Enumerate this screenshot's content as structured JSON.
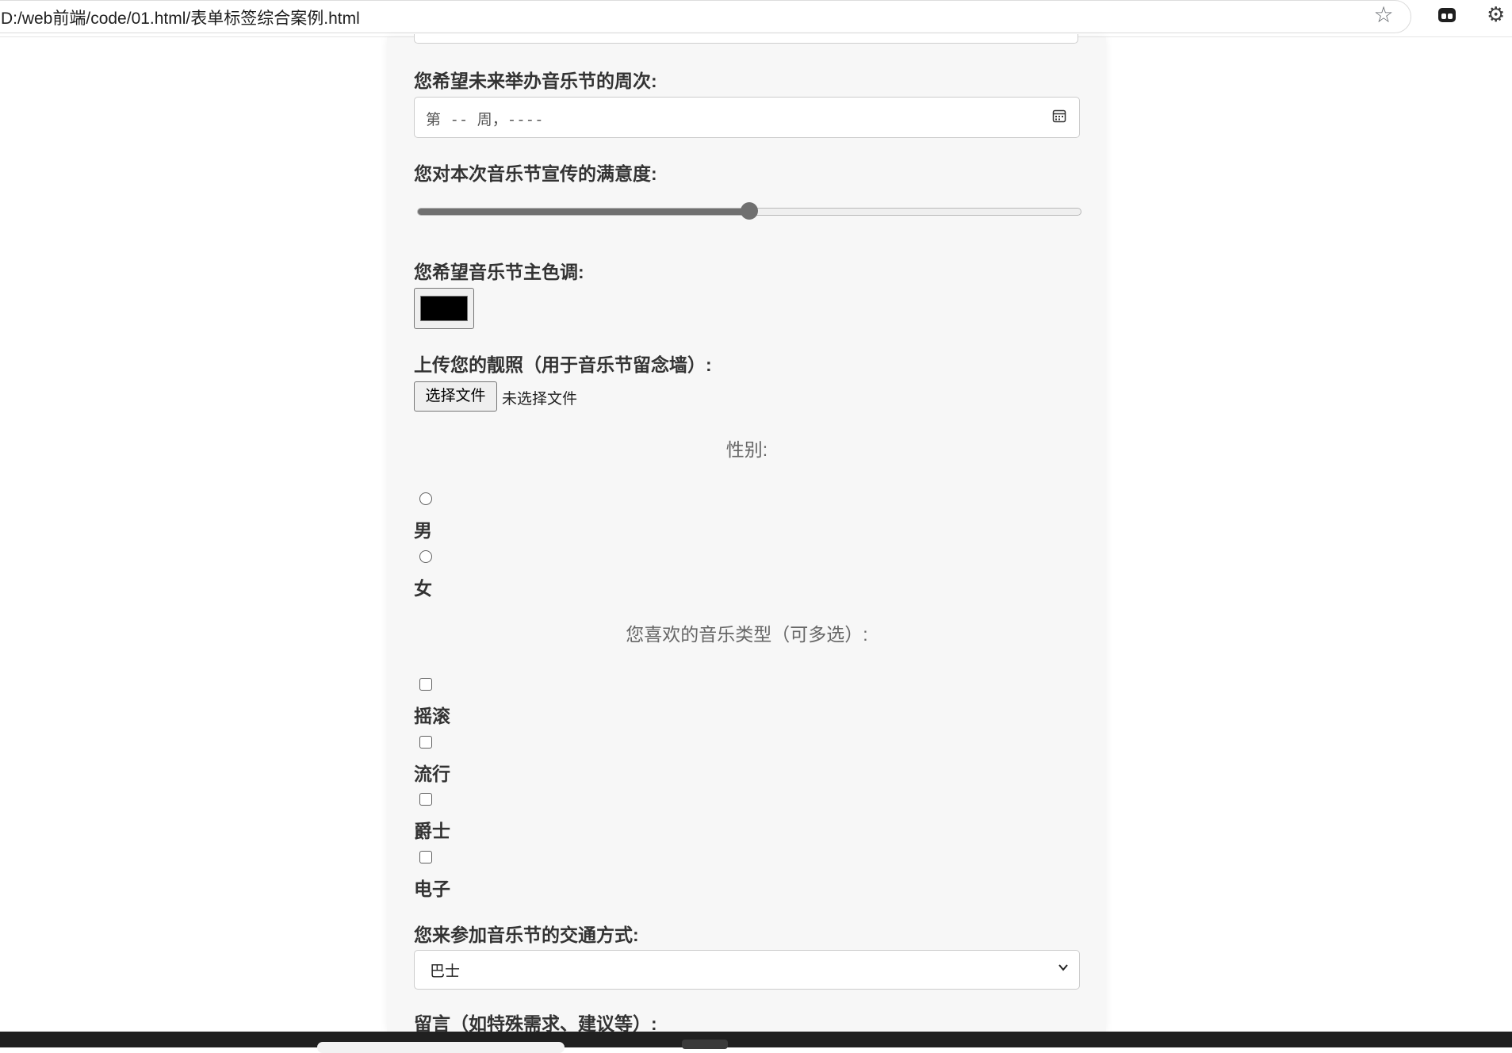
{
  "browser": {
    "url": "D:/web前端/code/01.html/表单标签综合案例.html",
    "bookmark_icon": "star-icon",
    "extension_icon": "extension-icon",
    "extensions_menu_icon": "puzzle-icon"
  },
  "form": {
    "week": {
      "label": "您希望未来举办音乐节的周次:",
      "placeholder": "第 -- 周，----",
      "icon": "calendar-icon"
    },
    "satisfaction": {
      "label": "您对本次音乐节宣传的满意度:",
      "value_fraction": 0.5
    },
    "color": {
      "label": "您希望音乐节主色调:",
      "value": "#000000"
    },
    "photo": {
      "label": "上传您的靓照（用于音乐节留念墙）:",
      "button": "选择文件",
      "status": "未选择文件"
    },
    "gender": {
      "caption": "性别:",
      "options": [
        "男",
        "女"
      ]
    },
    "genres": {
      "caption": "您喜欢的音乐类型（可多选）:",
      "options": [
        "摇滚",
        "流行",
        "爵士",
        "电子"
      ]
    },
    "transport": {
      "label": "您来参加音乐节的交通方式:",
      "selected": "巴士",
      "icon": "chevron-down-icon"
    },
    "message": {
      "label": "留言（如特殊需求、建议等）:"
    }
  },
  "colors": {
    "page_background": "#f7f7f7",
    "label_text": "#333333",
    "caption_text": "#666666",
    "slider_fill": "#707070"
  }
}
